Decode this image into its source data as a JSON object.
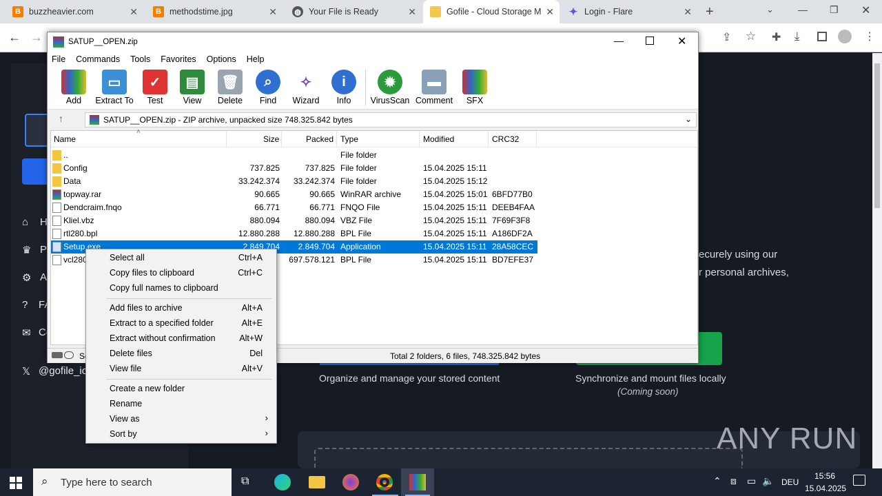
{
  "browser": {
    "tabs": [
      {
        "title": "buzzheavier.com",
        "icon": "b-icon"
      },
      {
        "title": "methodstime.jpg",
        "icon": "b-icon"
      },
      {
        "title": "Your File is Ready",
        "icon": "globe-icon"
      },
      {
        "title": "Gofile - Cloud Storage M",
        "icon": "folder-icon"
      },
      {
        "title": "Login - Flare",
        "icon": "flare-icon"
      }
    ]
  },
  "site": {
    "sidebar": [
      "H",
      "P",
      "A",
      "FA",
      "Co"
    ],
    "twitter": "@gofile_io",
    "text1": "ecurely using our",
    "text2": "r personal archives,",
    "feature1": "Organize and manage your stored content",
    "feature2": "Synchronize and mount files locally",
    "feature2_sub": "(Coming soon)",
    "watermark": "ANY RUN"
  },
  "winrar": {
    "title": "SATUP__OPEN.zip",
    "menu": [
      "File",
      "Commands",
      "Tools",
      "Favorites",
      "Options",
      "Help"
    ],
    "tools": [
      "Add",
      "Extract To",
      "Test",
      "View",
      "Delete",
      "Find",
      "Wizard",
      "Info",
      "VirusScan",
      "Comment",
      "SFX"
    ],
    "path": "SATUP__OPEN.zip - ZIP archive, unpacked size 748.325.842 bytes",
    "columns": [
      "Name",
      "Size",
      "Packed",
      "Type",
      "Modified",
      "CRC32"
    ],
    "rows": [
      {
        "name": "..",
        "size": "",
        "packed": "",
        "type": "File folder",
        "modified": "",
        "crc": ""
      },
      {
        "name": "Config",
        "size": "737.825",
        "packed": "737.825",
        "type": "File folder",
        "modified": "15.04.2025 15:11",
        "crc": ""
      },
      {
        "name": "Data",
        "size": "33.242.374",
        "packed": "33.242.374",
        "type": "File folder",
        "modified": "15.04.2025 15:12",
        "crc": ""
      },
      {
        "name": "topway.rar",
        "size": "90.665",
        "packed": "90.665",
        "type": "WinRAR archive",
        "modified": "15.04.2025 15:01",
        "crc": "6BFD77B0"
      },
      {
        "name": "Dendcraim.fnqo",
        "size": "66.771",
        "packed": "66.771",
        "type": "FNQO File",
        "modified": "15.04.2025 15:11",
        "crc": "DEEB4FAA"
      },
      {
        "name": "Kliel.vbz",
        "size": "880.094",
        "packed": "880.094",
        "type": "VBZ File",
        "modified": "15.04.2025 15:11",
        "crc": "7F69F3F8"
      },
      {
        "name": "rtl280.bpl",
        "size": "12.880.288",
        "packed": "12.880.288",
        "type": "BPL File",
        "modified": "15.04.2025 15:11",
        "crc": "A186DF2A"
      },
      {
        "name": "Setup.exe",
        "size": "2.849.704",
        "packed": "2.849.704",
        "type": "Application",
        "modified": "15.04.2025 15:11",
        "crc": "28A58CEC"
      },
      {
        "name": "vcl280",
        "size": "",
        "packed": "697.578.121",
        "type": "BPL File",
        "modified": "15.04.2025 15:11",
        "crc": "BD7EFE37"
      }
    ],
    "status_left": "Se",
    "status": "Total 2 folders, 6 files, 748.325.842 bytes"
  },
  "context_menu": [
    {
      "label": "Select all",
      "key": "Ctrl+A"
    },
    {
      "label": "Copy files to clipboard",
      "key": "Ctrl+C"
    },
    {
      "label": "Copy full names to clipboard",
      "key": ""
    },
    {
      "label": "Add files to archive",
      "key": "Alt+A"
    },
    {
      "label": "Extract to a specified folder",
      "key": "Alt+E"
    },
    {
      "label": "Extract without confirmation",
      "key": "Alt+W"
    },
    {
      "label": "Delete files",
      "key": "Del"
    },
    {
      "label": "View file",
      "key": "Alt+V"
    },
    {
      "label": "Create a new folder",
      "key": ""
    },
    {
      "label": "Rename",
      "key": ""
    },
    {
      "label": "View as",
      "key": ""
    },
    {
      "label": "Sort by",
      "key": ""
    }
  ],
  "taskbar": {
    "search_placeholder": "Type here to search",
    "lang": "DEU",
    "time": "15:56",
    "date": "15.04.2025"
  }
}
